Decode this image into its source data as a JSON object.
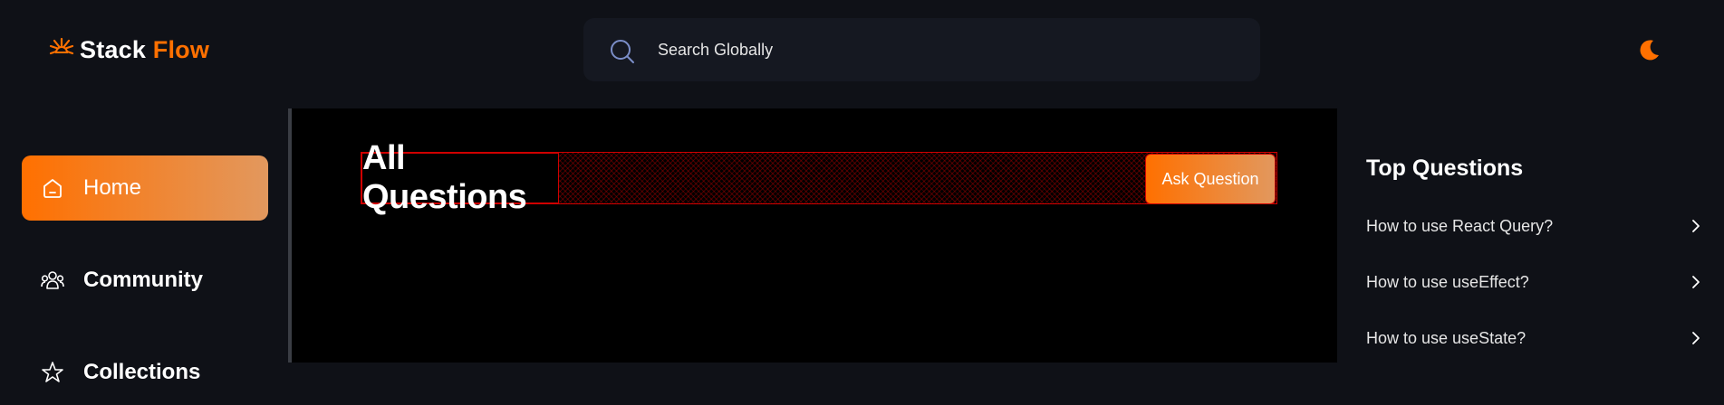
{
  "brand": {
    "name_part1": "Stack",
    "name_part2": "Flow",
    "logo_icon": "sunburst-logo-icon",
    "accent": "#ff7000"
  },
  "search": {
    "placeholder": "Search Globally",
    "icon": "search-icon"
  },
  "theme": {
    "icon": "moon-icon"
  },
  "sidebar": {
    "items": [
      {
        "label": "Home",
        "icon": "home-icon",
        "active": true
      },
      {
        "label": "Community",
        "icon": "users-icon",
        "active": false
      },
      {
        "label": "Collections",
        "icon": "star-icon",
        "active": false
      }
    ]
  },
  "main": {
    "title": "All Questions",
    "ask_label": "Ask Question"
  },
  "right_sidebar": {
    "title": "Top Questions",
    "questions": [
      "How to use React Query?",
      "How to use useEffect?",
      "How to use useState?"
    ]
  },
  "colors": {
    "background": "#0f1117",
    "main_background": "#000000",
    "gradient_start": "#ff7000",
    "gradient_end": "#e2985e",
    "debug_outline": "#d00000"
  }
}
